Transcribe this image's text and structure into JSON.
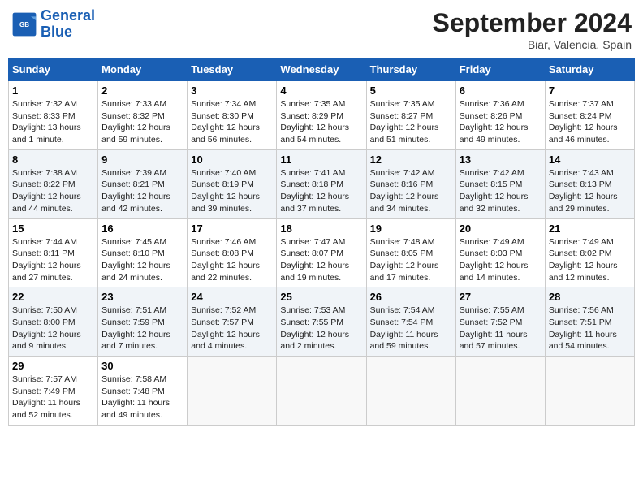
{
  "header": {
    "logo_line1": "General",
    "logo_line2": "Blue",
    "month": "September 2024",
    "location": "Biar, Valencia, Spain"
  },
  "days_of_week": [
    "Sunday",
    "Monday",
    "Tuesday",
    "Wednesday",
    "Thursday",
    "Friday",
    "Saturday"
  ],
  "weeks": [
    [
      {
        "num": "1",
        "info": "Sunrise: 7:32 AM\nSunset: 8:33 PM\nDaylight: 13 hours and 1 minute."
      },
      {
        "num": "2",
        "info": "Sunrise: 7:33 AM\nSunset: 8:32 PM\nDaylight: 12 hours and 59 minutes."
      },
      {
        "num": "3",
        "info": "Sunrise: 7:34 AM\nSunset: 8:30 PM\nDaylight: 12 hours and 56 minutes."
      },
      {
        "num": "4",
        "info": "Sunrise: 7:35 AM\nSunset: 8:29 PM\nDaylight: 12 hours and 54 minutes."
      },
      {
        "num": "5",
        "info": "Sunrise: 7:35 AM\nSunset: 8:27 PM\nDaylight: 12 hours and 51 minutes."
      },
      {
        "num": "6",
        "info": "Sunrise: 7:36 AM\nSunset: 8:26 PM\nDaylight: 12 hours and 49 minutes."
      },
      {
        "num": "7",
        "info": "Sunrise: 7:37 AM\nSunset: 8:24 PM\nDaylight: 12 hours and 46 minutes."
      }
    ],
    [
      {
        "num": "8",
        "info": "Sunrise: 7:38 AM\nSunset: 8:22 PM\nDaylight: 12 hours and 44 minutes."
      },
      {
        "num": "9",
        "info": "Sunrise: 7:39 AM\nSunset: 8:21 PM\nDaylight: 12 hours and 42 minutes."
      },
      {
        "num": "10",
        "info": "Sunrise: 7:40 AM\nSunset: 8:19 PM\nDaylight: 12 hours and 39 minutes."
      },
      {
        "num": "11",
        "info": "Sunrise: 7:41 AM\nSunset: 8:18 PM\nDaylight: 12 hours and 37 minutes."
      },
      {
        "num": "12",
        "info": "Sunrise: 7:42 AM\nSunset: 8:16 PM\nDaylight: 12 hours and 34 minutes."
      },
      {
        "num": "13",
        "info": "Sunrise: 7:42 AM\nSunset: 8:15 PM\nDaylight: 12 hours and 32 minutes."
      },
      {
        "num": "14",
        "info": "Sunrise: 7:43 AM\nSunset: 8:13 PM\nDaylight: 12 hours and 29 minutes."
      }
    ],
    [
      {
        "num": "15",
        "info": "Sunrise: 7:44 AM\nSunset: 8:11 PM\nDaylight: 12 hours and 27 minutes."
      },
      {
        "num": "16",
        "info": "Sunrise: 7:45 AM\nSunset: 8:10 PM\nDaylight: 12 hours and 24 minutes."
      },
      {
        "num": "17",
        "info": "Sunrise: 7:46 AM\nSunset: 8:08 PM\nDaylight: 12 hours and 22 minutes."
      },
      {
        "num": "18",
        "info": "Sunrise: 7:47 AM\nSunset: 8:07 PM\nDaylight: 12 hours and 19 minutes."
      },
      {
        "num": "19",
        "info": "Sunrise: 7:48 AM\nSunset: 8:05 PM\nDaylight: 12 hours and 17 minutes."
      },
      {
        "num": "20",
        "info": "Sunrise: 7:49 AM\nSunset: 8:03 PM\nDaylight: 12 hours and 14 minutes."
      },
      {
        "num": "21",
        "info": "Sunrise: 7:49 AM\nSunset: 8:02 PM\nDaylight: 12 hours and 12 minutes."
      }
    ],
    [
      {
        "num": "22",
        "info": "Sunrise: 7:50 AM\nSunset: 8:00 PM\nDaylight: 12 hours and 9 minutes."
      },
      {
        "num": "23",
        "info": "Sunrise: 7:51 AM\nSunset: 7:59 PM\nDaylight: 12 hours and 7 minutes."
      },
      {
        "num": "24",
        "info": "Sunrise: 7:52 AM\nSunset: 7:57 PM\nDaylight: 12 hours and 4 minutes."
      },
      {
        "num": "25",
        "info": "Sunrise: 7:53 AM\nSunset: 7:55 PM\nDaylight: 12 hours and 2 minutes."
      },
      {
        "num": "26",
        "info": "Sunrise: 7:54 AM\nSunset: 7:54 PM\nDaylight: 11 hours and 59 minutes."
      },
      {
        "num": "27",
        "info": "Sunrise: 7:55 AM\nSunset: 7:52 PM\nDaylight: 11 hours and 57 minutes."
      },
      {
        "num": "28",
        "info": "Sunrise: 7:56 AM\nSunset: 7:51 PM\nDaylight: 11 hours and 54 minutes."
      }
    ],
    [
      {
        "num": "29",
        "info": "Sunrise: 7:57 AM\nSunset: 7:49 PM\nDaylight: 11 hours and 52 minutes."
      },
      {
        "num": "30",
        "info": "Sunrise: 7:58 AM\nSunset: 7:48 PM\nDaylight: 11 hours and 49 minutes."
      },
      {
        "num": "",
        "info": ""
      },
      {
        "num": "",
        "info": ""
      },
      {
        "num": "",
        "info": ""
      },
      {
        "num": "",
        "info": ""
      },
      {
        "num": "",
        "info": ""
      }
    ]
  ]
}
